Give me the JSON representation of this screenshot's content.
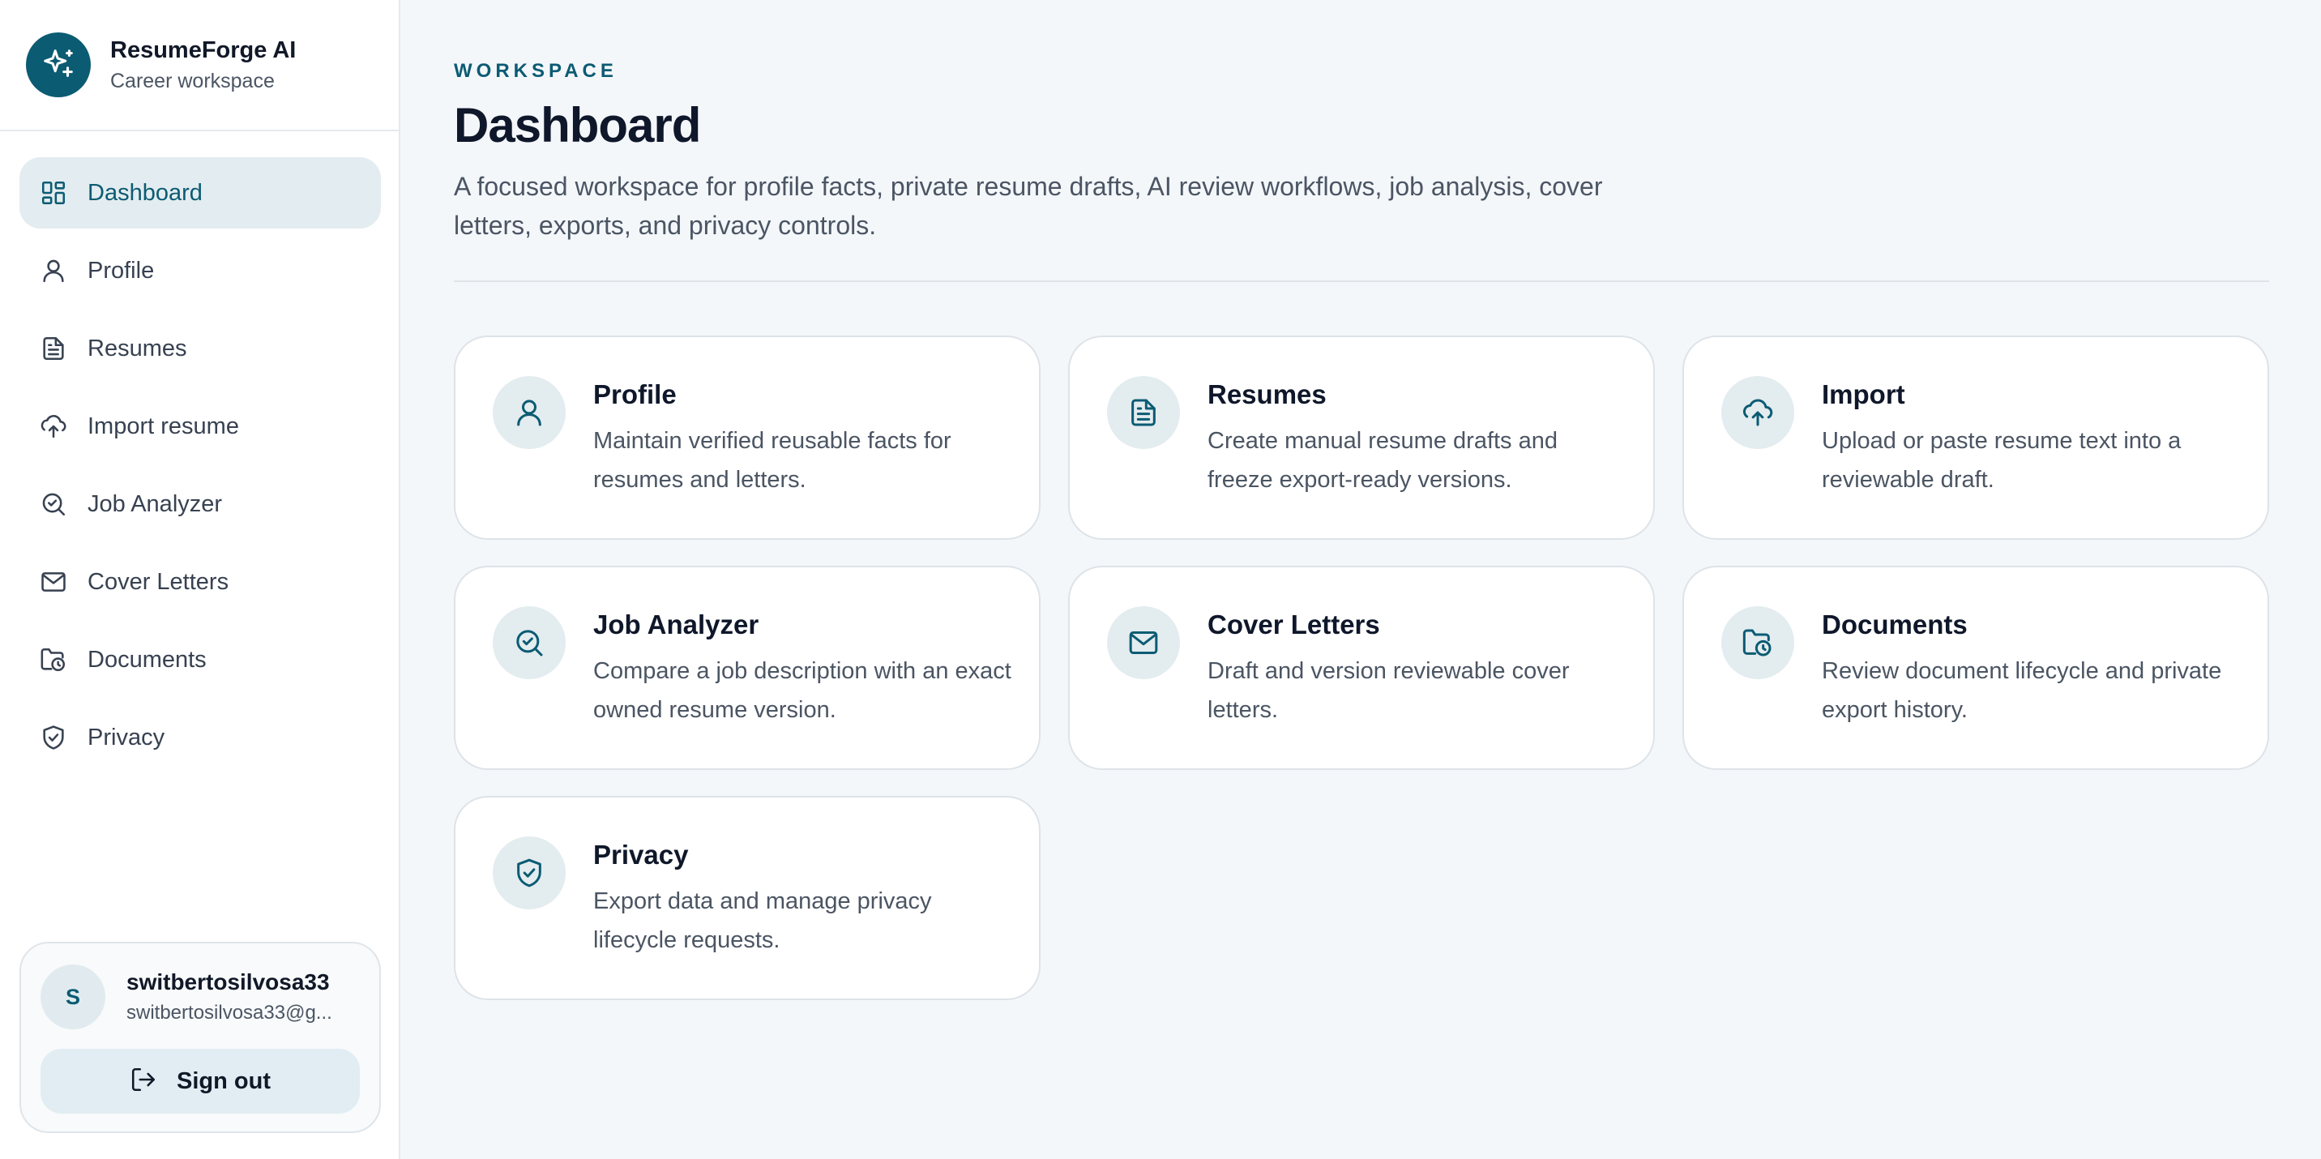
{
  "brand": {
    "title": "ResumeForge AI",
    "subtitle": "Career workspace",
    "icon": "sparkles-icon"
  },
  "sidebar": {
    "items": [
      {
        "label": "Dashboard",
        "icon": "dashboard-icon",
        "active": true
      },
      {
        "label": "Profile",
        "icon": "user-icon"
      },
      {
        "label": "Resumes",
        "icon": "file-text-icon"
      },
      {
        "label": "Import resume",
        "icon": "cloud-upload-icon"
      },
      {
        "label": "Job Analyzer",
        "icon": "search-check-icon"
      },
      {
        "label": "Cover Letters",
        "icon": "mail-icon"
      },
      {
        "label": "Documents",
        "icon": "folder-clock-icon"
      },
      {
        "label": "Privacy",
        "icon": "shield-check-icon"
      }
    ]
  },
  "user": {
    "initial": "S",
    "name": "switbertosilvosa33",
    "email": "switbertosilvosa33@g...",
    "signout_label": "Sign out"
  },
  "main": {
    "eyebrow": "WORKSPACE",
    "title": "Dashboard",
    "description": "A focused workspace for profile facts, private resume drafts, AI review workflows, job analysis, cover letters, exports, and privacy controls.",
    "cards": [
      {
        "title": "Profile",
        "desc": "Maintain verified reusable facts for resumes and letters.",
        "icon": "user-icon"
      },
      {
        "title": "Resumes",
        "desc": "Create manual resume drafts and freeze export-ready versions.",
        "icon": "file-text-icon"
      },
      {
        "title": "Import",
        "desc": "Upload or paste resume text into a reviewable draft.",
        "icon": "cloud-upload-icon"
      },
      {
        "title": "Job Analyzer",
        "desc": "Compare a job description with an exact owned resume version.",
        "icon": "search-check-icon"
      },
      {
        "title": "Cover Letters",
        "desc": "Draft and version reviewable cover letters.",
        "icon": "mail-icon"
      },
      {
        "title": "Documents",
        "desc": "Review document lifecycle and private export history.",
        "icon": "folder-clock-icon"
      },
      {
        "title": "Privacy",
        "desc": "Export data and manage privacy lifecycle requests.",
        "icon": "shield-check-icon"
      }
    ]
  },
  "colors": {
    "accent": "#0b5b73",
    "active_bg": "#e3ecf0",
    "page_bg": "#f4f7fa"
  }
}
